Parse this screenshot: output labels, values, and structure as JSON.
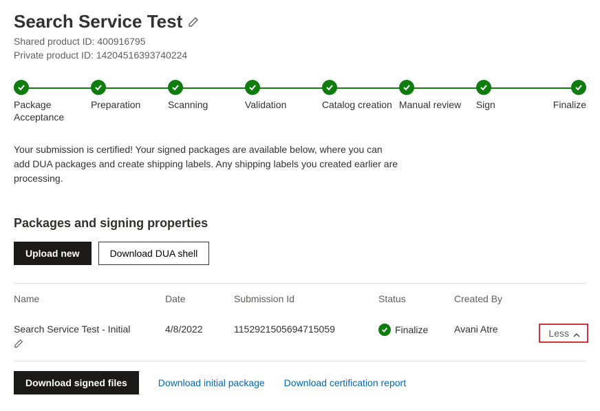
{
  "title": "Search Service Test",
  "shared_product_id_label": "Shared product ID: 400916795",
  "private_product_id_label": "Private product ID: 14204516393740224",
  "steps": [
    {
      "label": "Package Acceptance"
    },
    {
      "label": "Preparation"
    },
    {
      "label": "Scanning"
    },
    {
      "label": "Validation"
    },
    {
      "label": "Catalog creation"
    },
    {
      "label": "Manual review"
    },
    {
      "label": "Sign"
    },
    {
      "label": "Finalize"
    }
  ],
  "status_text": "Your submission is certified! Your signed packages are available below, where you can add DUA packages and create shipping labels. Any shipping labels you created earlier are processing.",
  "section_title": "Packages and signing properties",
  "buttons": {
    "upload_new": "Upload new",
    "download_dua": "Download DUA shell"
  },
  "table": {
    "headers": {
      "name": "Name",
      "date": "Date",
      "submission_id": "Submission Id",
      "status": "Status",
      "created_by": "Created By"
    },
    "row": {
      "name": "Search Service Test - Initial",
      "date": "4/8/2022",
      "submission_id": "1152921505694715059",
      "status": "Finalize",
      "created_by": "Avani Atre",
      "toggle_label": "Less"
    }
  },
  "actions": {
    "download_signed": "Download signed files",
    "download_initial": "Download initial package",
    "download_cert": "Download certification report"
  }
}
